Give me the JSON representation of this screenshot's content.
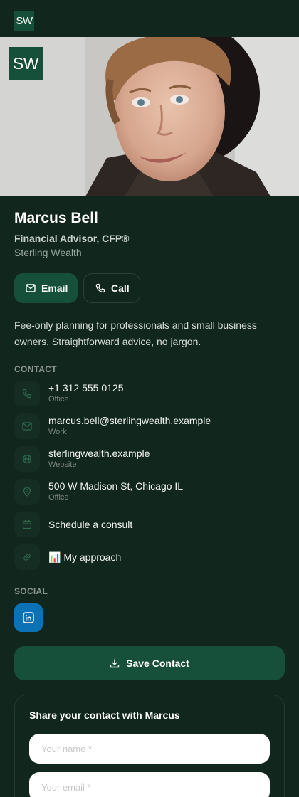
{
  "brand": {
    "initials": "SW",
    "accent": "#17503a",
    "background": "#11261d"
  },
  "profile": {
    "name": "Marcus Bell",
    "title": "Financial Advisor, CFP®",
    "company": "Sterling Wealth",
    "bio": "Fee-only planning for professionals and small business owners. Straightforward advice, no jargon."
  },
  "actions": {
    "email_label": "Email",
    "call_label": "Call"
  },
  "contact": {
    "label": "CONTACT",
    "items": [
      {
        "icon": "phone-icon",
        "value": "+1 312 555 0125",
        "sub": "Office"
      },
      {
        "icon": "mail-icon",
        "value": "marcus.bell@sterlingwealth.example",
        "sub": "Work"
      },
      {
        "icon": "globe-icon",
        "value": "sterlingwealth.example",
        "sub": "Website"
      },
      {
        "icon": "map-pin-icon",
        "value": "500 W Madison St, Chicago IL",
        "sub": "Office"
      },
      {
        "icon": "calendar-icon",
        "value": "Schedule a consult",
        "sub": ""
      },
      {
        "icon": "link-icon",
        "value": "📊 My approach",
        "sub": ""
      }
    ]
  },
  "social": {
    "label": "SOCIAL",
    "items": [
      {
        "icon": "linkedin-icon",
        "color": "#0a72b5"
      }
    ]
  },
  "save": {
    "label": "Save Contact"
  },
  "share": {
    "title": "Share your contact with Marcus",
    "name_placeholder": "Your name *",
    "email_placeholder": "Your email *"
  }
}
